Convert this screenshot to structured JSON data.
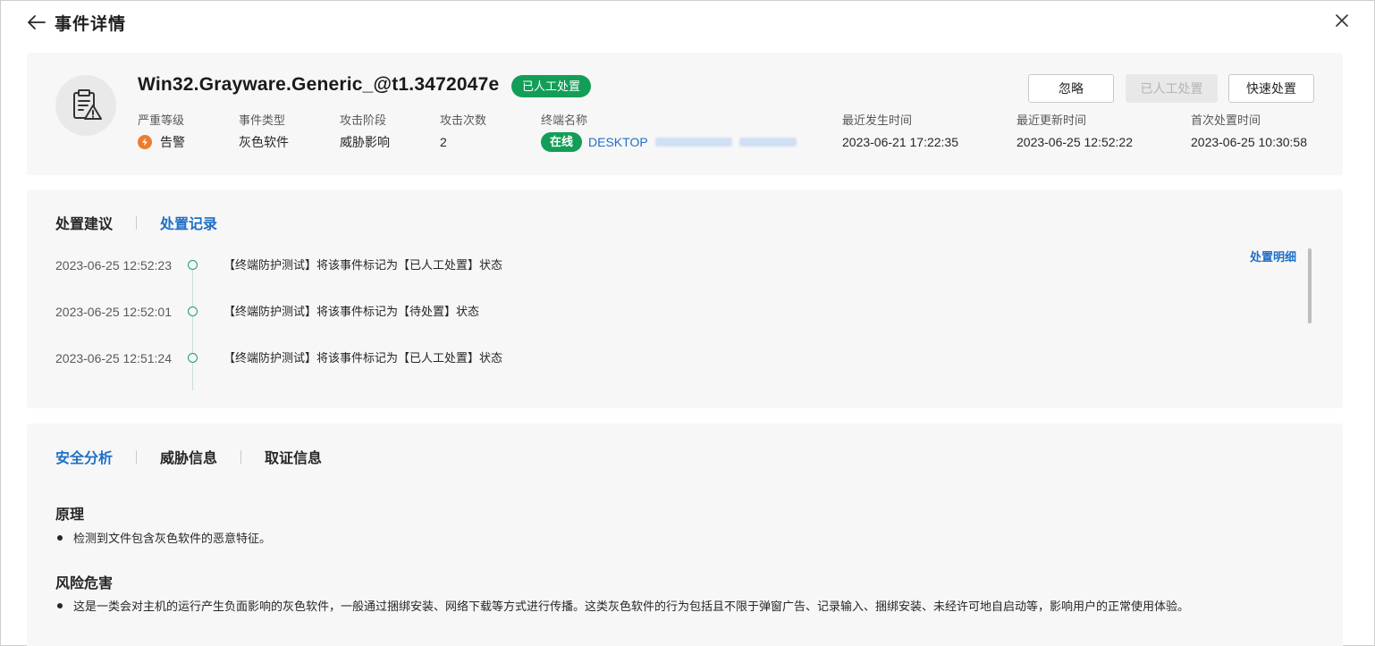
{
  "header": {
    "title": "事件详情",
    "icons": {
      "back": "arrow-left-icon",
      "close": "close-icon"
    }
  },
  "event": {
    "name": "Win32.Grayware.Generic_@t1.3472047e",
    "status": "已人工处置",
    "icon": "file-warning-icon",
    "actions": {
      "ignore": "忽略",
      "manual": "已人工处置",
      "quick": "快速处置"
    },
    "fields": {
      "severity_label": "严重等级",
      "severity_value": "告警",
      "type_label": "事件类型",
      "type_value": "灰色软件",
      "stage_label": "攻击阶段",
      "stage_value": "威胁影响",
      "count_label": "攻击次数",
      "count_value": "2",
      "terminal_label": "终端名称",
      "terminal_status": "在线",
      "terminal_name": "DESKTOP",
      "last_occur_label": "最近发生时间",
      "last_occur_value": "2023-06-21 17:22:35",
      "last_update_label": "最近更新时间",
      "last_update_value": "2023-06-25 12:52:22",
      "first_handle_label": "首次处置时间",
      "first_handle_value": "2023-06-25 10:30:58"
    },
    "colors": {
      "success": "#139e57",
      "warning": "#ee7b2e",
      "link": "#1e6fc6"
    }
  },
  "records": {
    "tabs": [
      "处置建议",
      "处置记录"
    ],
    "active_tab": "处置记录",
    "detail_link": "处置明细",
    "items": [
      {
        "time": "2023-06-25 12:52:23",
        "text": "【终端防护测试】将该事件标记为【已人工处置】状态"
      },
      {
        "time": "2023-06-25 12:52:01",
        "text": "【终端防护测试】将该事件标记为【待处置】状态"
      },
      {
        "time": "2023-06-25 12:51:24",
        "text": "【终端防护测试】将该事件标记为【已人工处置】状态"
      }
    ]
  },
  "analysis": {
    "tabs": [
      "安全分析",
      "威胁信息",
      "取证信息"
    ],
    "active_tab": "安全分析",
    "principle_title": "原理",
    "principle_text": "检测到文件包含灰色软件的恶意特征。",
    "risk_title": "风险危害",
    "risk_text": "这是一类会对主机的运行产生负面影响的灰色软件，一般通过捆绑安装、网络下载等方式进行传播。这类灰色软件的行为包括且不限于弹窗广告、记录输入、捆绑安装、未经许可地自启动等，影响用户的正常使用体验。"
  }
}
